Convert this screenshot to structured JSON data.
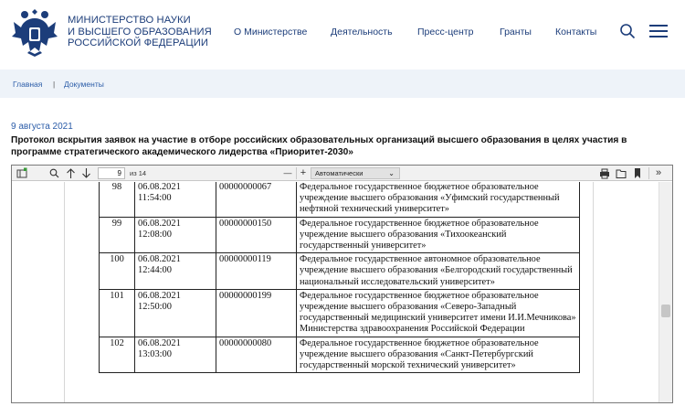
{
  "header": {
    "org_line1": "МИНИСТЕРСТВО НАУКИ",
    "org_line2": "И ВЫСШЕГО ОБРАЗОВАНИЯ",
    "org_line3": "РОССИЙСКОЙ ФЕДЕРАЦИИ",
    "nav": [
      "О Министерстве",
      "Деятельность",
      "Пресс-центр",
      "Гранты",
      "Контакты"
    ],
    "brand_color": "#1c3d7a"
  },
  "breadcrumb": {
    "home": "Главная",
    "separator": "|",
    "current": "Документы"
  },
  "article": {
    "date": "9 августа 2021",
    "title": "Протокол вскрытия заявок на участие в отборе российских образовательных организаций высшего образования в целях участия в программе стратегического академического лидерства «Приоритет-2030»"
  },
  "pdf_viewer": {
    "page_number": "9",
    "page_total": "из 14",
    "zoom": "Автоматически",
    "zoom_minus": "—",
    "zoom_plus": "+",
    "icons": [
      "sidebar-toggle-icon",
      "search-icon",
      "arrow-up-icon",
      "arrow-down-icon",
      "print-icon",
      "open-file-icon",
      "bookmark-icon",
      "tools-icon"
    ],
    "rows": [
      {
        "num": "98",
        "date": "06.08.2021",
        "time": "11:54:00",
        "code": "00000000067",
        "org": "Федеральное государственное бюджетное образовательное учреждение высшего образования «Уфимский государственный нефтяной технический университет»"
      },
      {
        "num": "99",
        "date": "06.08.2021",
        "time": "12:08:00",
        "code": "00000000150",
        "org": "Федеральное государственное бюджетное образовательное учреждение высшего образования «Тихоокеанский государственный университет»"
      },
      {
        "num": "100",
        "date": "06.08.2021",
        "time": "12:44:00",
        "code": "00000000119",
        "org": "Федеральное государственное автономное образовательное учреждение высшего образования «Белгородский государственный национальный исследовательский университет»"
      },
      {
        "num": "101",
        "date": "06.08.2021",
        "time": "12:50:00",
        "code": "00000000199",
        "org": "Федеральное государственное бюджетное образовательное учреждение высшего образования «Северо-Западный государственный медицинский университет имени И.И.Мечникова» Министерства здравоохранения Российской Федерации"
      },
      {
        "num": "102",
        "date": "06.08.2021",
        "time": "13:03:00",
        "code": "00000000080",
        "org": "Федеральное государственное бюджетное образовательное учреждение высшего образования «Санкт-Петербургский государственный морской технический университет»"
      }
    ]
  }
}
